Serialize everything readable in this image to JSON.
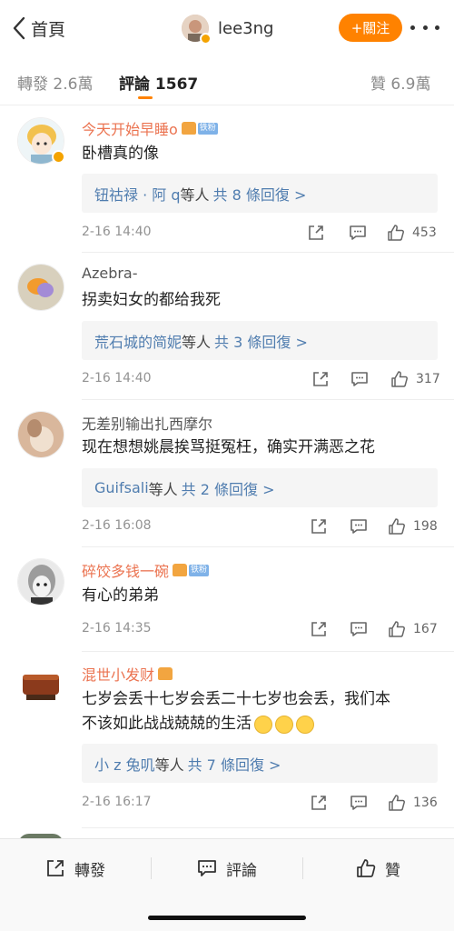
{
  "nav": {
    "back_label": "首頁",
    "username": "lee3ng",
    "follow_label": "+關注"
  },
  "tabs": {
    "repost": "轉發 2.6萬",
    "comments": "評論 1567",
    "likes": "贊 6.9萬"
  },
  "comments": [
    {
      "name": "今天开始早睡o",
      "badge": "铁粉",
      "text": "卧槽真的像",
      "reply_names": "钮祜禄 · 阿 q",
      "reply_mid": " 等人",
      "reply_count": "共 8 條回復 >",
      "time": "2-16 14:40",
      "likes": "453"
    },
    {
      "name": "Azebra-",
      "text": "拐卖妇女的都给我死",
      "reply_names": "荒石城的简妮",
      "reply_mid": "等人",
      "reply_count": "共 3 條回復 >",
      "time": "2-16 14:40",
      "likes": "317"
    },
    {
      "name": "无差别输出扎西摩尔",
      "text": "现在想想姚晨挨骂挺冤枉，确实开满恶之花",
      "reply_names": "Guifsali",
      "reply_mid": " 等人",
      "reply_count": "共 2 條回復 >",
      "time": "2-16 16:08",
      "likes": "198"
    },
    {
      "name": "碎饺多钱一碗",
      "badge": "铁粉",
      "text": "有心的弟弟",
      "time": "2-16 14:35",
      "likes": "167"
    },
    {
      "name": "混世小发财",
      "text_line1": "七岁会丢十七岁会丢二十七岁也会丢，我们本",
      "text_line2": "不该如此战战兢兢的生活",
      "reply_names": "小 z 兔叽",
      "reply_mid": "等人",
      "reply_count": "共 7 條回復 >",
      "time": "2-16 16:17",
      "likes": "136"
    }
  ],
  "bottom": {
    "repost": "轉發",
    "comment": "評論",
    "like": "贊"
  },
  "colors": {
    "accent": "#ff8200",
    "name_highlight": "#eb7350",
    "link_blue": "#507daf"
  }
}
